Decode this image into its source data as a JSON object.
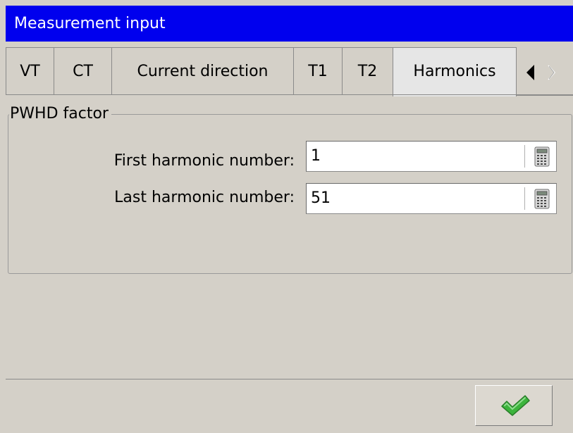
{
  "window": {
    "title": "Measurement input"
  },
  "tabs": [
    {
      "label": "VT",
      "active": false
    },
    {
      "label": "CT",
      "active": false
    },
    {
      "label": "Current direction",
      "active": false
    },
    {
      "label": "T1",
      "active": false
    },
    {
      "label": "T2",
      "active": false
    },
    {
      "label": "Harmonics",
      "active": true
    }
  ],
  "tab_scroll": {
    "left_icon": "triangle-left-icon",
    "right_icon": "triangle-right-disabled-icon"
  },
  "group": {
    "title": "PWHD factor",
    "fields": [
      {
        "label": "First harmonic number:",
        "value": "1",
        "icon": "calculator-icon"
      },
      {
        "label": "Last harmonic number:",
        "value": "51",
        "icon": "calculator-icon"
      }
    ]
  },
  "footer": {
    "ok_icon": "green-checkmark-icon"
  },
  "colors": {
    "titlebar": "#0000ee",
    "titlebar_text": "#ffffff",
    "background": "#d4d0c8",
    "checkmark": "#3cb43c"
  }
}
